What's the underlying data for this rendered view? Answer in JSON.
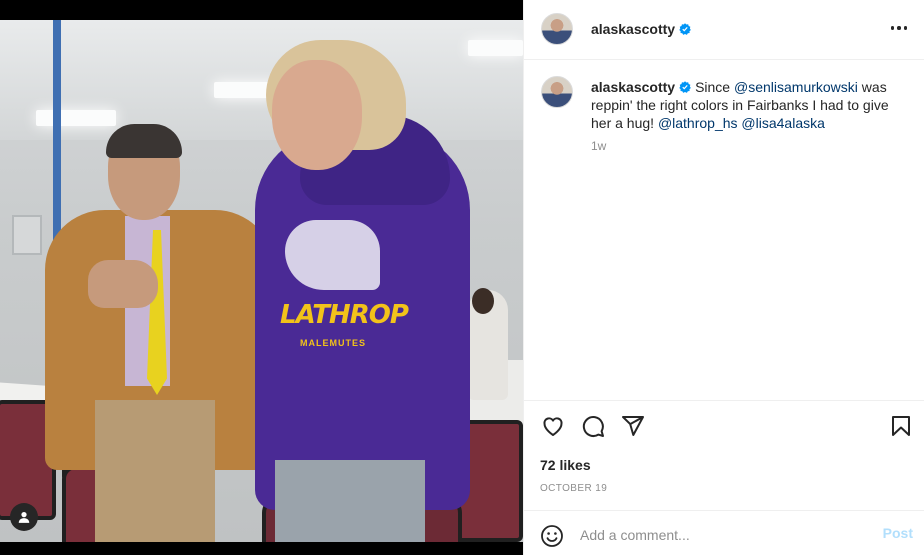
{
  "post": {
    "username": "alaskascotty",
    "verified": true,
    "caption_prefix": "Since ",
    "mention_1": "@senlisamurkowski",
    "caption_middle": " was reppin' the right colors in Fairbanks I had to give her a hug! ",
    "mention_2": "@lathrop_hs",
    "mention_3": "@lisa4alaska",
    "time_ago": "1w",
    "likes": "72 likes",
    "date": "OCTOBER 19"
  },
  "photo": {
    "hoodie_text": "LATHROP",
    "hoodie_subtext": "MALEMUTES"
  },
  "comment": {
    "placeholder": "Add a comment...",
    "post_label": "Post"
  },
  "colors": {
    "link": "#00376b",
    "verified_badge": "#0095f6",
    "post_disabled": "#b2dffc"
  },
  "icons": {
    "like": "heart-icon",
    "comment": "comment-icon",
    "share": "paper-plane-icon",
    "save": "bookmark-icon",
    "more": "more-icon",
    "emoji": "emoji-icon",
    "tagged": "user-tag-icon"
  }
}
